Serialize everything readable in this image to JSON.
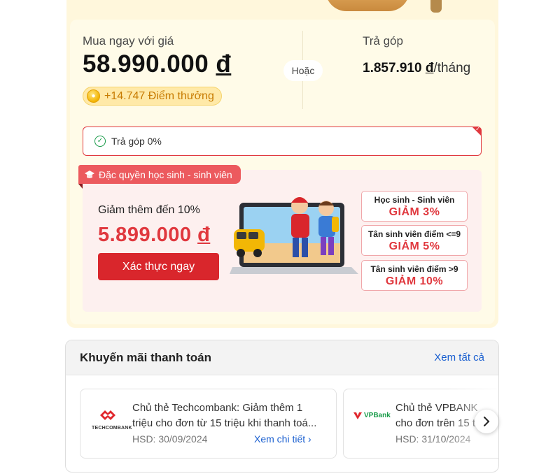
{
  "price": {
    "buy_label": "Mua ngay với giá",
    "buy_value": "58.990.000",
    "currency": "đ",
    "points": "+14.747 Điểm thưởng",
    "or_label": "Hoặc",
    "installment_label": "Trả góp",
    "installment_value": "1.857.910",
    "installment_unit": "/tháng"
  },
  "installment_option": {
    "label": "Trả góp 0%"
  },
  "student": {
    "tag": "Đặc quyền học sinh - sinh viên",
    "discount_label": "Giảm thêm đến 10%",
    "discount_value": "5.899.000",
    "currency": "đ",
    "verify_button": "Xác thực ngay",
    "tiers": [
      {
        "title": "Học sinh - Sinh viên",
        "discount": "GIẢM 3%"
      },
      {
        "title": "Tân sinh viên điểm <=9",
        "discount": "GIẢM 5%"
      },
      {
        "title": "Tân sinh viên điểm >9",
        "discount": "GIẢM 10%"
      }
    ]
  },
  "payment_promos": {
    "title": "Khuyến mãi thanh toán",
    "see_all": "Xem tất cả",
    "cards": [
      {
        "bank": "TECHCOMBANK",
        "line1": "Chủ thẻ Techcombank: Giảm thêm 1",
        "line2": "triệu cho đơn từ 15 triệu khi thanh toá...",
        "expiry": "HSD: 30/09/2024",
        "more": "Xem chi tiết"
      },
      {
        "bank": "VPBank",
        "line1": "Chủ thẻ VPBANK",
        "line2": "cho đơn trên 15 t",
        "expiry": "HSD: 31/10/2024"
      }
    ]
  },
  "colors": {
    "accent_red": "#e0383e",
    "link_blue": "#1a5fd0",
    "points_gold": "#c77a00"
  }
}
